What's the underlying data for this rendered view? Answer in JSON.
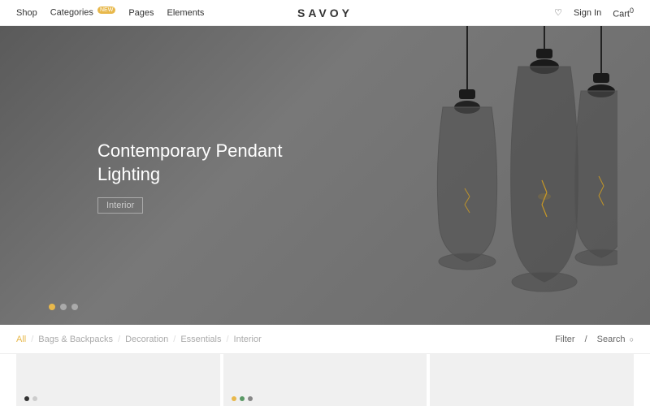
{
  "header": {
    "nav": [
      {
        "label": "Shop",
        "href": "#"
      },
      {
        "label": "Categories",
        "badge": "NEW",
        "href": "#"
      },
      {
        "label": "Pages",
        "href": "#"
      },
      {
        "label": "Elements",
        "href": "#"
      }
    ],
    "logo": "SAVOY",
    "sign_in": "Sign In",
    "cart": "Cart",
    "cart_count": "0"
  },
  "hero": {
    "title": "Contemporary Pendant\nLighting",
    "subtitle": "Interior",
    "dots": [
      {
        "active": true
      },
      {
        "active": false
      },
      {
        "active": false
      }
    ]
  },
  "filter_bar": {
    "categories": [
      {
        "label": "All",
        "active": true
      },
      {
        "label": "Bags & Backpacks",
        "active": false
      },
      {
        "label": "Decoration",
        "active": false
      },
      {
        "label": "Essentials",
        "active": false
      },
      {
        "label": "Interior",
        "active": false
      }
    ],
    "filter_label": "Filter",
    "search_label": "Search"
  },
  "products": [
    {
      "dots": [
        {
          "color": "#333"
        },
        {
          "color": "#ccc"
        }
      ]
    },
    {
      "dots": [
        {
          "color": "#e8b84b"
        },
        {
          "color": "#5a9"
        },
        {
          "color": "#888"
        }
      ]
    },
    {}
  ]
}
